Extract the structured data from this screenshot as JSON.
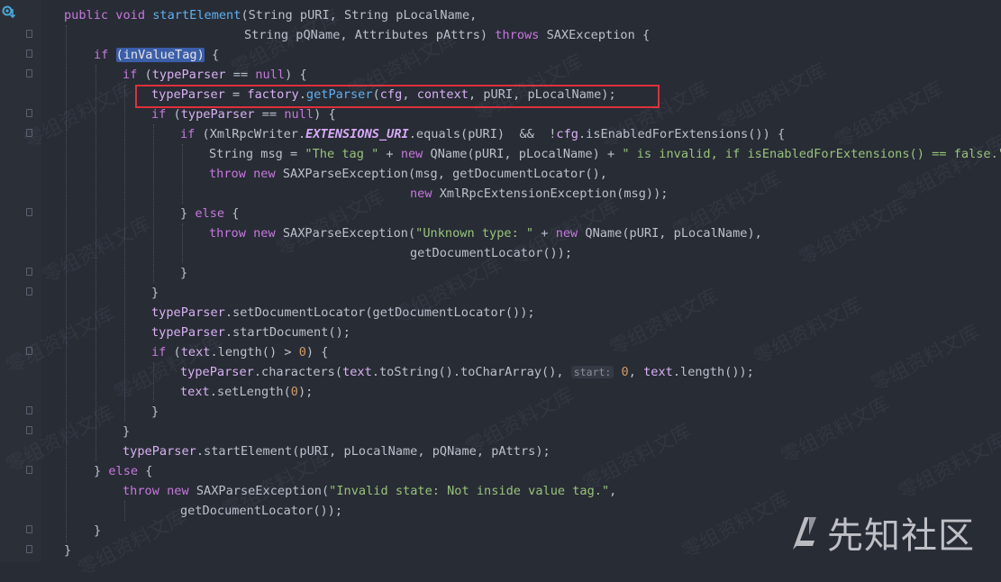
{
  "editor": {
    "method": {
      "modifiers": "public void",
      "name": "startElement",
      "params_a": "(String pURI, String pLocalName,",
      "params_b": "String pQName, Attributes pAttrs)",
      "throws": "throws",
      "exc": "SAXException {"
    },
    "tokens": {
      "if": "if",
      "else": "else",
      "throw": "throw",
      "new": "new",
      "null": "null",
      "inValueTag": "inValueTag",
      "typeParser": "typeParser",
      "factory": "factory",
      "cfg": "cfg",
      "context": "context",
      "text": "text",
      "extensions_uri": "EXTENSIONS_URI",
      "zero": "0"
    },
    "strings": {
      "tag": "\"The tag \"",
      "invalid": "\" is invalid, if isEnabledForExtensions() == false.\"",
      "unknown": "\"Unknown type: \"",
      "state": "\"Invalid state: Not inside value tag.\""
    },
    "hint": "start:"
  },
  "watermark": {
    "text": "零组资料文库"
  },
  "brand": {
    "logo_icon": "xianzhi-logo-icon",
    "text": "先知社区"
  }
}
